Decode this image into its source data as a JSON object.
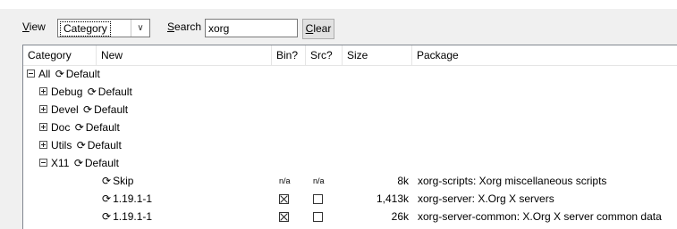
{
  "toolbar": {
    "view_label_mnemonic": "V",
    "view_label_rest": "iew",
    "view_value": "Category",
    "search_label_mnemonic": "S",
    "search_label_rest": "earch",
    "search_value": "xorg",
    "clear_mnemonic": "C",
    "clear_rest": "lear"
  },
  "columns": [
    "Category",
    "New",
    "Bin?",
    "Src?",
    "Size",
    "Package"
  ],
  "tree": {
    "all_label": "All",
    "all_value": "Default",
    "groups": [
      {
        "name": "Debug",
        "value": "Default"
      },
      {
        "name": "Devel",
        "value": "Default"
      },
      {
        "name": "Doc",
        "value": "Default"
      },
      {
        "name": "Utils",
        "value": "Default"
      },
      {
        "name": "X11",
        "value": "Default"
      }
    ]
  },
  "packages": [
    {
      "new": "Skip",
      "bin": "n/a",
      "src": "n/a",
      "bin_checked": false,
      "src_checked": false,
      "size": "8k",
      "package": "xorg-scripts: Xorg miscellaneous scripts"
    },
    {
      "new": "1.19.1-1",
      "bin": "",
      "src": "",
      "bin_checked": true,
      "src_checked": false,
      "size": "1,413k",
      "package": "xorg-server: X.Org X servers"
    },
    {
      "new": "1.19.1-1",
      "bin": "",
      "src": "",
      "bin_checked": true,
      "src_checked": false,
      "size": "26k",
      "package": "xorg-server-common: X.Org X server common data"
    }
  ],
  "icons": {
    "cycle": "cycle-arrows-icon"
  }
}
